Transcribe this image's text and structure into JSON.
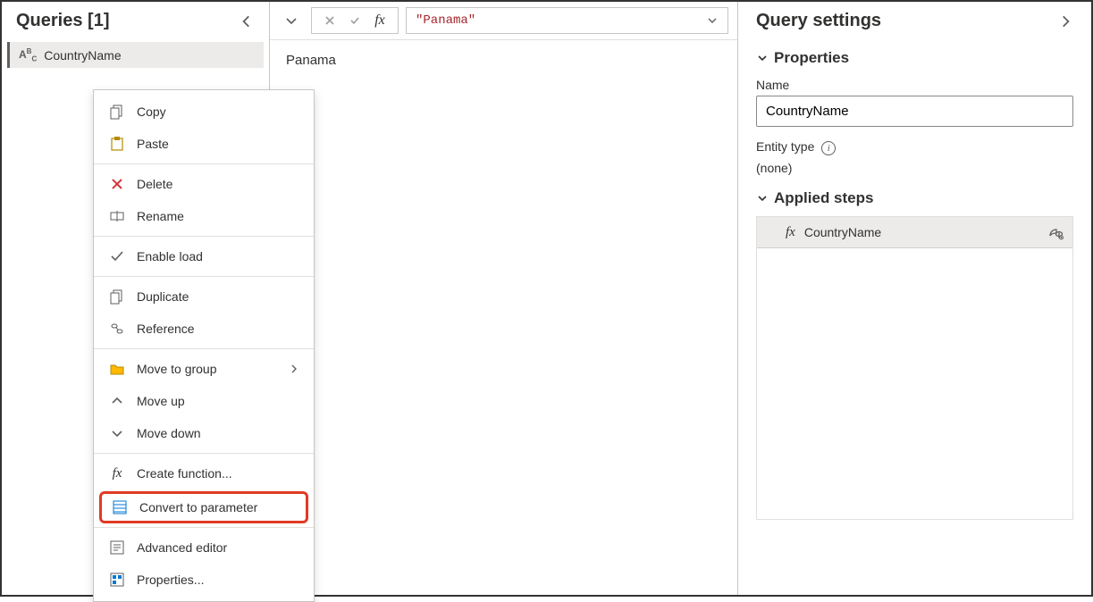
{
  "queries": {
    "header": "Queries [1]",
    "items": [
      {
        "label": "CountryName"
      }
    ]
  },
  "context_menu": {
    "items": [
      {
        "label": "Copy",
        "icon": "copy-icon"
      },
      {
        "label": "Paste",
        "icon": "paste-icon"
      }
    ],
    "items2": [
      {
        "label": "Delete",
        "icon": "delete-icon"
      },
      {
        "label": "Rename",
        "icon": "rename-icon"
      }
    ],
    "items3": [
      {
        "label": "Enable load",
        "icon": "checkmark-icon"
      }
    ],
    "items4": [
      {
        "label": "Duplicate",
        "icon": "duplicate-icon"
      },
      {
        "label": "Reference",
        "icon": "reference-icon"
      }
    ],
    "items5": [
      {
        "label": "Move to group",
        "icon": "folder-icon",
        "submenu": true
      },
      {
        "label": "Move up",
        "icon": "up-icon"
      },
      {
        "label": "Move down",
        "icon": "down-icon"
      }
    ],
    "items6": [
      {
        "label": "Create function...",
        "icon": "fx-icon"
      },
      {
        "label": "Convert to parameter",
        "icon": "parameter-icon",
        "highlighted": true
      }
    ],
    "items7": [
      {
        "label": "Advanced editor",
        "icon": "advanced-editor-icon"
      },
      {
        "label": "Properties...",
        "icon": "properties-icon"
      }
    ]
  },
  "formula_bar": {
    "text": "\"Panama\""
  },
  "result": {
    "value": "Panama"
  },
  "settings": {
    "header": "Query settings",
    "properties_label": "Properties",
    "name_label": "Name",
    "name_value": "CountryName",
    "entity_type_label": "Entity type",
    "entity_type_value": "(none)",
    "applied_steps_label": "Applied steps",
    "steps": [
      {
        "label": "CountryName"
      }
    ]
  }
}
